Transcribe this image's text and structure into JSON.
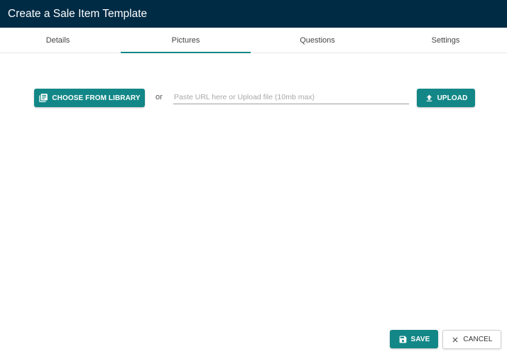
{
  "window": {
    "title": "Create a Sale Item Template"
  },
  "tabs": [
    {
      "label": "Details",
      "active": false
    },
    {
      "label": "Pictures",
      "active": true
    },
    {
      "label": "Questions",
      "active": false
    },
    {
      "label": "Settings",
      "active": false
    }
  ],
  "pictures": {
    "library_button": {
      "label": "CHOOSE FROM LIBRARY",
      "icon": "library-icon"
    },
    "or_text": "or",
    "url_input": {
      "value": "",
      "placeholder": "Paste URL here or Upload file (10mb max)"
    },
    "upload_button": {
      "label": "UPLOAD",
      "icon": "upload-icon"
    }
  },
  "footer": {
    "save_button": {
      "label": "SAVE",
      "icon": "save-icon"
    },
    "cancel_button": {
      "label": "CANCEL",
      "icon": "close-icon"
    }
  },
  "colors": {
    "titlebar": "#002b45",
    "accent": "#138787"
  }
}
